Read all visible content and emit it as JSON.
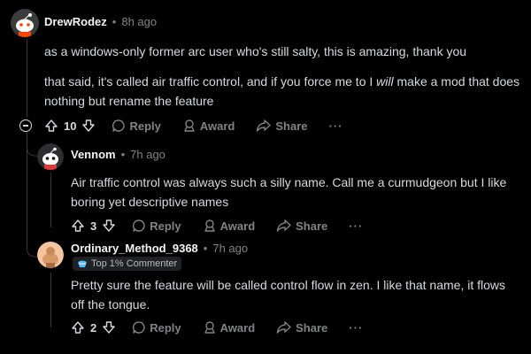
{
  "comments": [
    {
      "username": "DrewRodez",
      "time": "8h ago",
      "paragraph1": "as a windows-only former arc user who's still salty, this is amazing, thank you",
      "paragraph2_part1": "that said, it's called air traffic control, and if you force me to I ",
      "paragraph2_em": "will",
      "paragraph2_part2": " make a mod that does nothing but rename the feature",
      "votes": "10",
      "reply_label": "Reply",
      "award_label": "Award",
      "share_label": "Share",
      "more_label": "···"
    },
    {
      "username": "Vennom",
      "time": "7h ago",
      "paragraph1": "Air traffic control was always such a silly name. Call me a curmudgeon but I like boring yet descriptive names",
      "votes": "3",
      "reply_label": "Reply",
      "award_label": "Award",
      "share_label": "Share",
      "more_label": "···"
    },
    {
      "username": "Ordinary_Method_9368",
      "time": "7h ago",
      "badge": "Top 1% Commenter",
      "paragraph1": "Pretty sure the feature will be called control flow in zen. I like that name, it flows off the tongue.",
      "votes": "2",
      "reply_label": "Reply",
      "award_label": "Award",
      "share_label": "Share",
      "more_label": "···"
    }
  ],
  "separator": "•"
}
